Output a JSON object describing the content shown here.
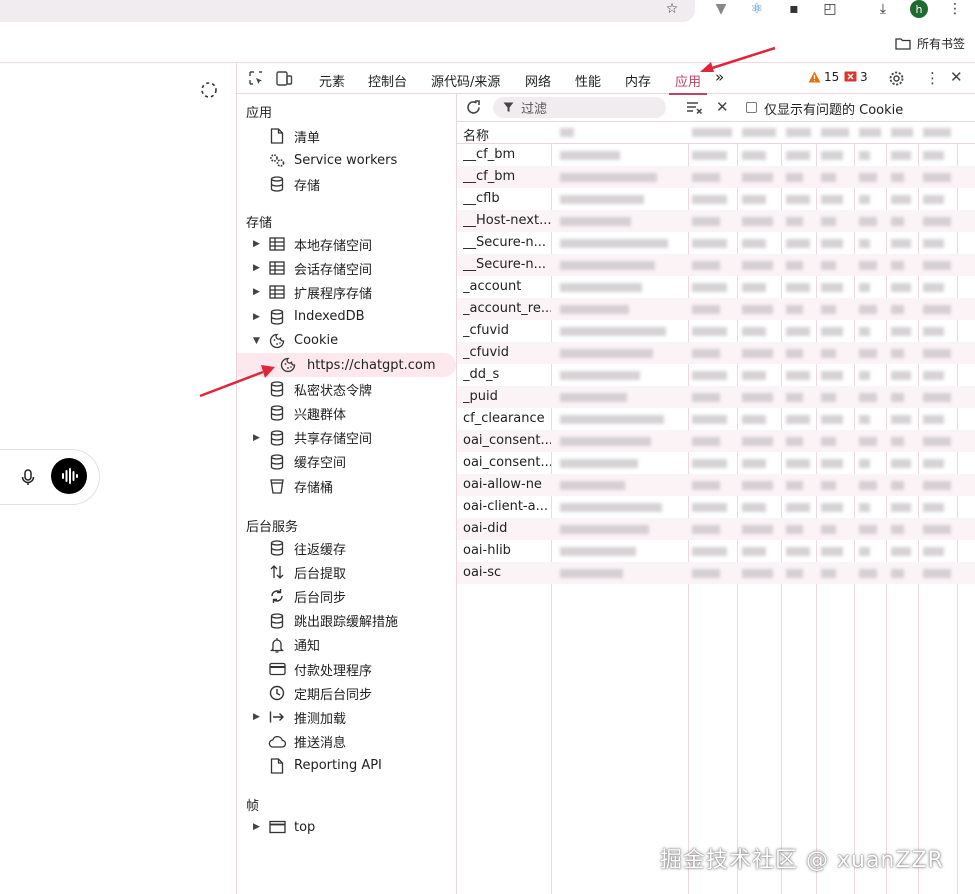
{
  "browser": {
    "toolbar_icons": [
      "star-icon",
      "extension-v-icon",
      "react-icon",
      "extension-icon",
      "puzzle-icon",
      "download-icon",
      "avatar",
      "more-icon"
    ],
    "avatar_letter": "h",
    "bookmarks_all_label": "所有书签"
  },
  "devtools": {
    "tabs": [
      "元素",
      "控制台",
      "源代码/来源",
      "网络",
      "性能",
      "内存",
      "应用"
    ],
    "active_tab": "应用",
    "warnings_count": "15",
    "errors_count": "3"
  },
  "sidebar": {
    "section_app": "应用",
    "app_items": [
      {
        "label": "清单",
        "icon": "file-icon"
      },
      {
        "label": "Service workers",
        "icon": "gears-icon"
      },
      {
        "label": "存储",
        "icon": "database-icon"
      }
    ],
    "section_storage": "存储",
    "storage_items": [
      {
        "label": "本地存储空间",
        "icon": "table-icon",
        "expandable": true
      },
      {
        "label": "会话存储空间",
        "icon": "table-icon",
        "expandable": true
      },
      {
        "label": "扩展程序存储",
        "icon": "table-icon",
        "expandable": true
      },
      {
        "label": "IndexedDB",
        "icon": "database-icon",
        "expandable": true
      },
      {
        "label": "Cookie",
        "icon": "cookie-icon",
        "expandable": true,
        "expanded": true
      },
      {
        "label": "https://chatgpt.com",
        "icon": "cookie-icon",
        "selected": true,
        "sub": true
      },
      {
        "label": "私密状态令牌",
        "icon": "database-icon"
      },
      {
        "label": "兴趣群体",
        "icon": "database-icon"
      },
      {
        "label": "共享存储空间",
        "icon": "database-icon",
        "expandable": true
      },
      {
        "label": "缓存空间",
        "icon": "database-icon"
      },
      {
        "label": "存储桶",
        "icon": "bucket-icon"
      }
    ],
    "section_background": "后台服务",
    "background_items": [
      {
        "label": "往返缓存",
        "icon": "database-icon"
      },
      {
        "label": "后台提取",
        "icon": "updown-icon"
      },
      {
        "label": "后台同步",
        "icon": "sync-icon"
      },
      {
        "label": "跳出跟踪缓解措施",
        "icon": "database-icon"
      },
      {
        "label": "通知",
        "icon": "bell-icon"
      },
      {
        "label": "付款处理程序",
        "icon": "card-icon"
      },
      {
        "label": "定期后台同步",
        "icon": "clock-icon"
      },
      {
        "label": "推测加载",
        "icon": "arrow-bar-icon",
        "expandable": true
      },
      {
        "label": "推送消息",
        "icon": "cloud-icon"
      },
      {
        "label": "Reporting API",
        "icon": "file-icon"
      }
    ],
    "section_frames": "帧",
    "frame_items": [
      {
        "label": "top",
        "icon": "window-icon",
        "expandable": true
      }
    ]
  },
  "cookies": {
    "filter_placeholder": "过滤",
    "only_issues_label": "仅显示有问题的 Cookie",
    "name_header": "名称",
    "names": [
      "__cf_bm",
      "__cf_bm",
      "__cflb",
      "__Host-next...",
      "__Secure-n...",
      "__Secure-n...",
      "_account",
      "_account_re...",
      "_cfuvid",
      "_cfuvid",
      "_dd_s",
      "_puid",
      "cf_clearance",
      "oai_consent...",
      "oai_consent...",
      "oai-allow-ne",
      "oai-client-a...",
      "oai-did",
      "oai-hlib",
      "oai-sc"
    ]
  },
  "watermark": "掘金技术社区 @ xuanZZR",
  "colors": {
    "accent": "#c14263",
    "arrow": "#e0263a"
  }
}
